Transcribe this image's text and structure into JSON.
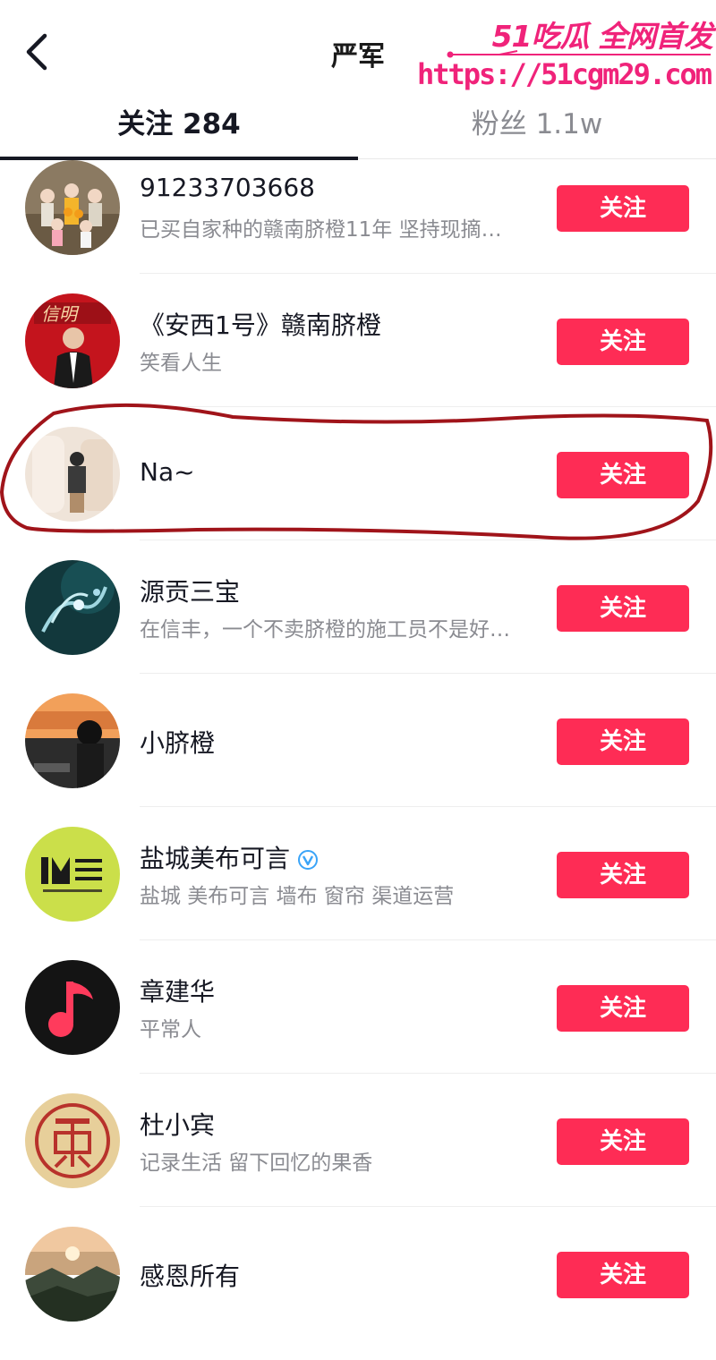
{
  "header": {
    "title": "严军",
    "back_icon": "chevron-left-icon"
  },
  "watermark": {
    "brand": "51吃瓜 全网首发",
    "url": "https://51cgm29.com",
    "color": "#f0237a"
  },
  "tabs": [
    {
      "label": "关注 284",
      "active": true
    },
    {
      "label": "粉丝 1.1w",
      "active": false
    }
  ],
  "accent": "#fe2c55",
  "users": [
    {
      "name": "91233703668",
      "desc": "已买自家种的赣南脐橙11年 坚持现摘…",
      "button": "关注"
    },
    {
      "name": "《安西1号》赣南脐橙",
      "desc": "笑看人生",
      "button": "关注"
    },
    {
      "name": "Na~",
      "desc": "",
      "button": "关注"
    },
    {
      "name": "源贡三宝",
      "desc": "在信丰，一个不卖脐橙的施工员不是好…",
      "button": "关注"
    },
    {
      "name": "小脐橙",
      "desc": "",
      "button": "关注"
    },
    {
      "name": "盐城美布可言",
      "desc": "盐城 美布可言 墙布 窗帘 渠道运营",
      "button": "关注",
      "verified": true
    },
    {
      "name": "章建华",
      "desc": "平常人",
      "button": "关注"
    },
    {
      "name": "杜小宾",
      "desc": "记录生活 留下回忆的果香",
      "button": "关注"
    },
    {
      "name": "感恩所有",
      "desc": "",
      "button": "关注"
    }
  ]
}
